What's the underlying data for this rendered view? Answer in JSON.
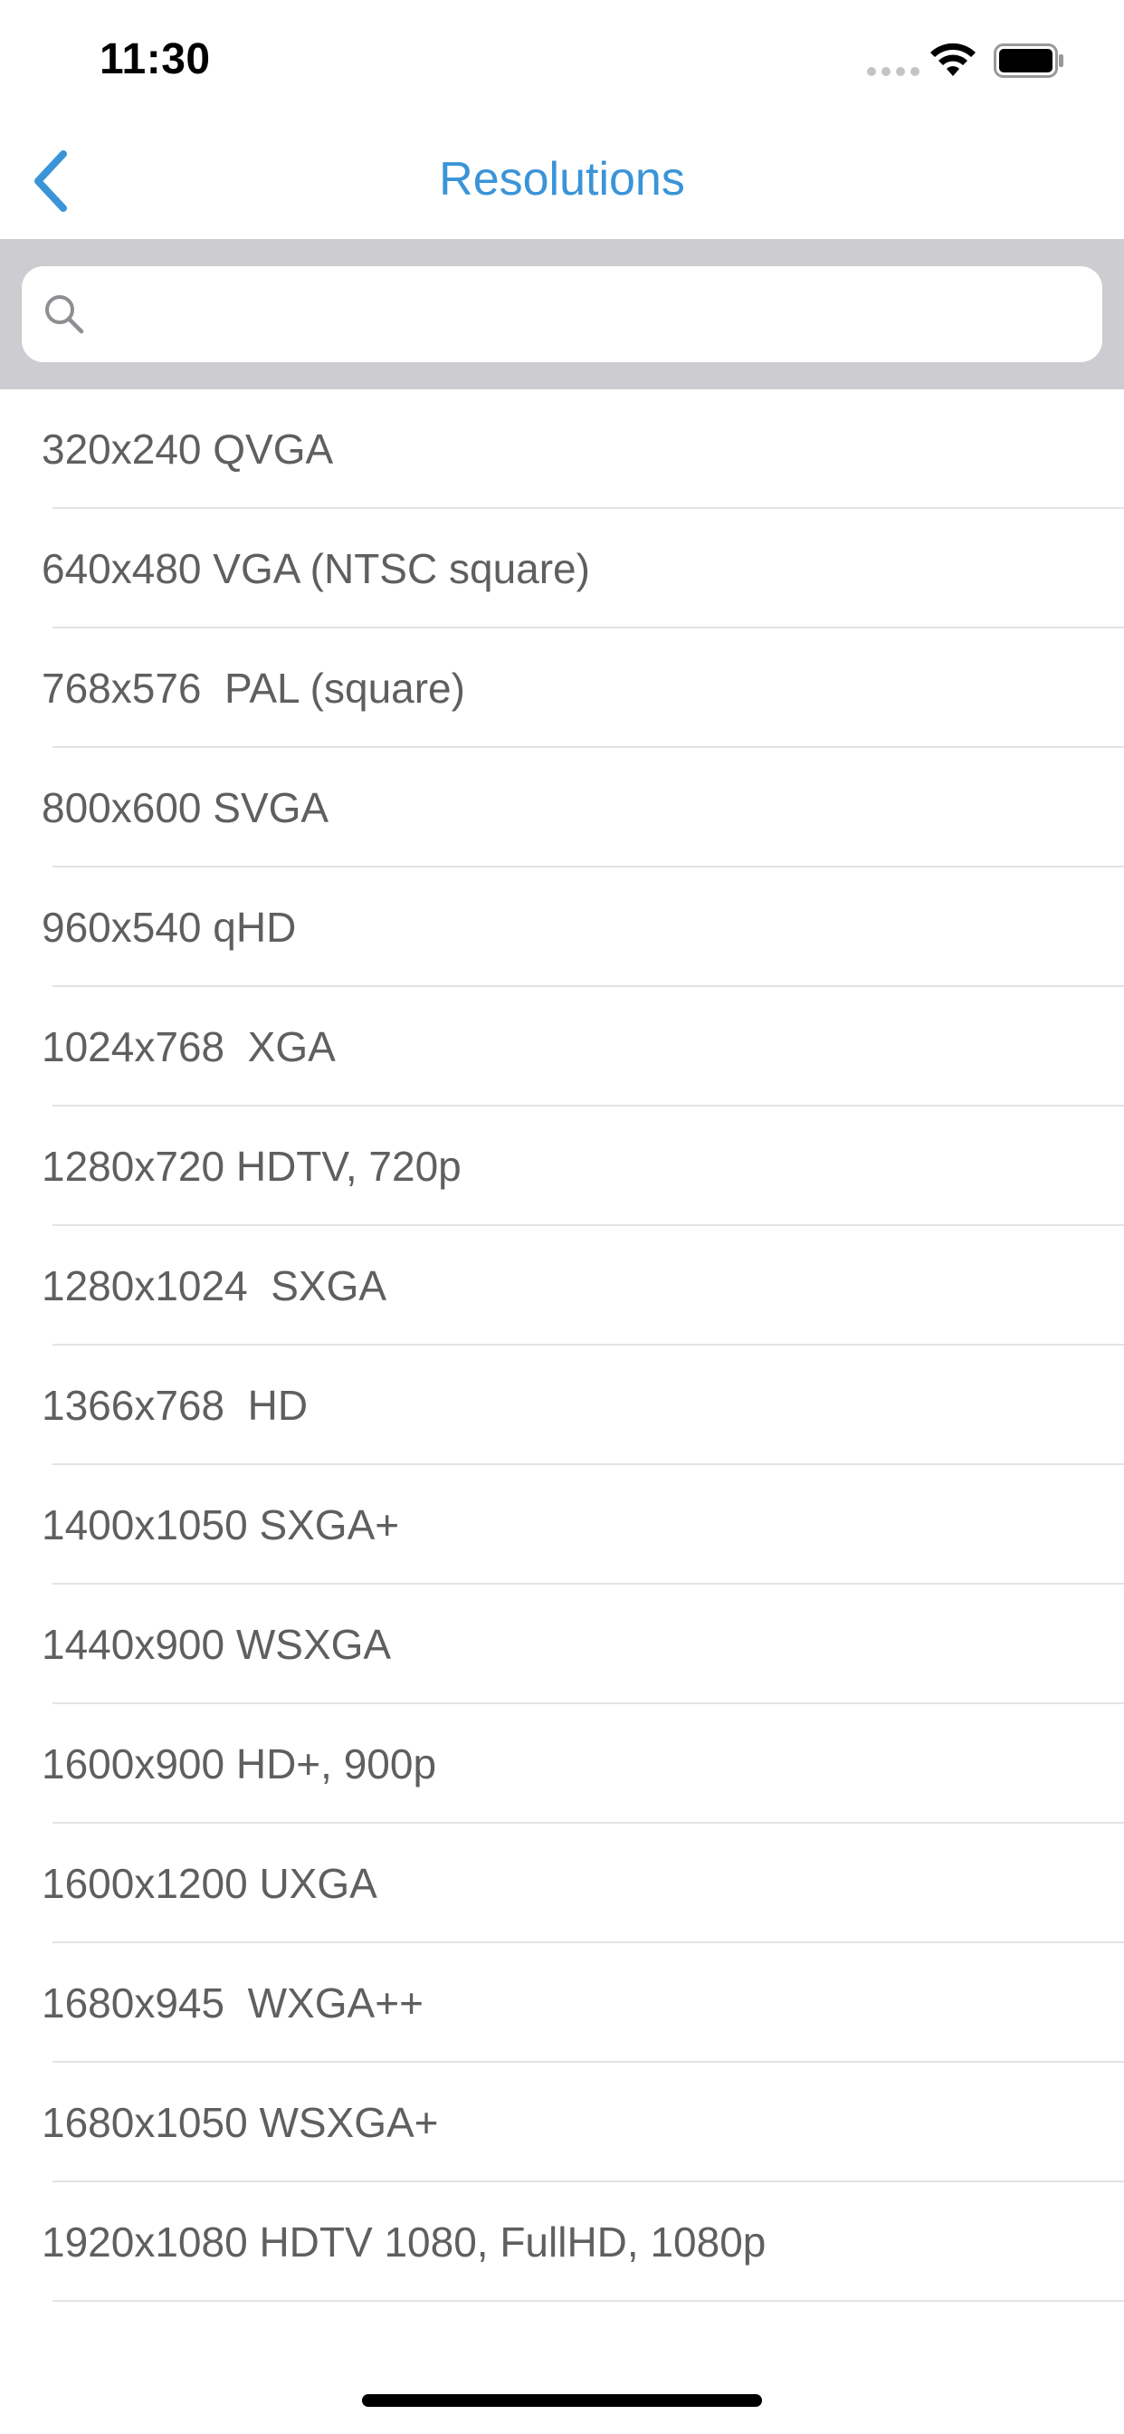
{
  "status_bar": {
    "time": "11:30",
    "icons": [
      "signal-dots-icon",
      "wifi-icon",
      "battery-icon"
    ]
  },
  "nav": {
    "title": "Resolutions",
    "back_icon": "chevron-left-icon"
  },
  "search": {
    "value": "",
    "icon": "search-icon"
  },
  "colors": {
    "accent": "#3a94d8",
    "search_bar_background": "#cdcdd1",
    "list_text": "#5f5f5f",
    "divider": "#e3e3e6"
  },
  "list": {
    "items": [
      {
        "label": "320x240 QVGA"
      },
      {
        "label": "640x480 VGA (NTSC square)"
      },
      {
        "label": "768x576  PAL (square)"
      },
      {
        "label": "800x600 SVGA"
      },
      {
        "label": "960x540 qHD"
      },
      {
        "label": "1024x768  XGA"
      },
      {
        "label": "1280x720 HDTV, 720p"
      },
      {
        "label": "1280x1024  SXGA"
      },
      {
        "label": "1366x768  HD"
      },
      {
        "label": "1400x1050 SXGA+"
      },
      {
        "label": "1440x900 WSXGA"
      },
      {
        "label": "1600x900 HD+, 900p"
      },
      {
        "label": "1600x1200 UXGA"
      },
      {
        "label": "1680x945  WXGA++"
      },
      {
        "label": "1680x1050 WSXGA+"
      },
      {
        "label": "1920x1080 HDTV 1080, FullHD, 1080p"
      }
    ]
  }
}
